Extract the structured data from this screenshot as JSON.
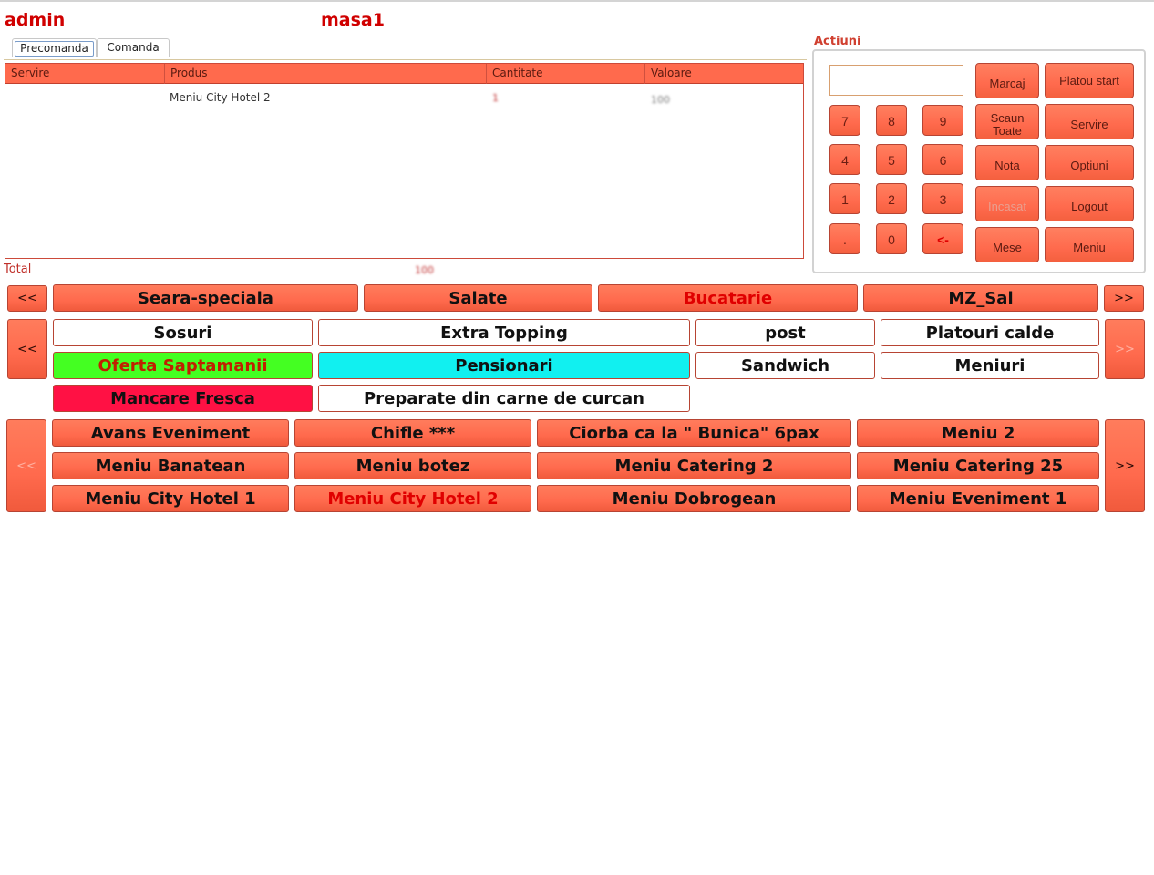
{
  "header": {
    "user": "admin",
    "table": "masa1"
  },
  "tabs": [
    {
      "label": "Precomanda",
      "active": true
    },
    {
      "label": "Comanda",
      "active": false
    }
  ],
  "order_table": {
    "columns": [
      "Servire",
      "Produs",
      "Cantitate",
      "Valoare"
    ],
    "rows": [
      {
        "servire": "",
        "produs": "Meniu City Hotel 2",
        "cantitate": "1",
        "valoare": "100"
      }
    ]
  },
  "total": {
    "label": "Total",
    "value": "100"
  },
  "actions": {
    "title": "Actiuni",
    "input_value": "",
    "keys": [
      "7",
      "8",
      "9",
      "4",
      "5",
      "6",
      "1",
      "2",
      "3",
      ".",
      "0",
      "<-"
    ],
    "buttons": {
      "marcaj": "Marcaj",
      "platou_start": "Platou start",
      "scaun_toate_1": "Scaun",
      "scaun_toate_2": "Toate",
      "servire": "Servire",
      "nota": "Nota",
      "optiuni": "Optiuni",
      "incasat": "Incasat",
      "logout": "Logout",
      "mese": "Mese",
      "meniu": "Meniu"
    }
  },
  "categories": {
    "prev": "<<",
    "next": ">>",
    "items": [
      "Seara-speciala",
      "Salate",
      "Bucatarie",
      "MZ_Sal"
    ],
    "selected": "Bucatarie"
  },
  "subcategories": {
    "prev": "<<",
    "next": ">>",
    "items": [
      "Sosuri",
      "Extra Topping",
      "post",
      "Platouri calde",
      "Oferta Saptamanii",
      "Pensionari",
      "Sandwich",
      "Meniuri",
      "Mancare Fresca",
      "Preparate din carne de curcan"
    ],
    "colors": {
      "green": "#44ff22",
      "cyan": "#11f0f0",
      "red": "#ff1144",
      "green_text": "#c02000"
    }
  },
  "products": {
    "prev": "<<",
    "next": ">>",
    "items": [
      "Avans Eveniment",
      "Chifle ***",
      "Ciorba ca la \" Bunica\" 6pax",
      "Meniu 2",
      "Meniu Banatean",
      "Meniu botez",
      "Meniu Catering 2",
      "Meniu Catering 25",
      "Meniu City Hotel 1",
      "Meniu City Hotel 2",
      "Meniu Dobrogean",
      "Meniu Eveniment 1"
    ],
    "selected": "Meniu City Hotel 2"
  }
}
